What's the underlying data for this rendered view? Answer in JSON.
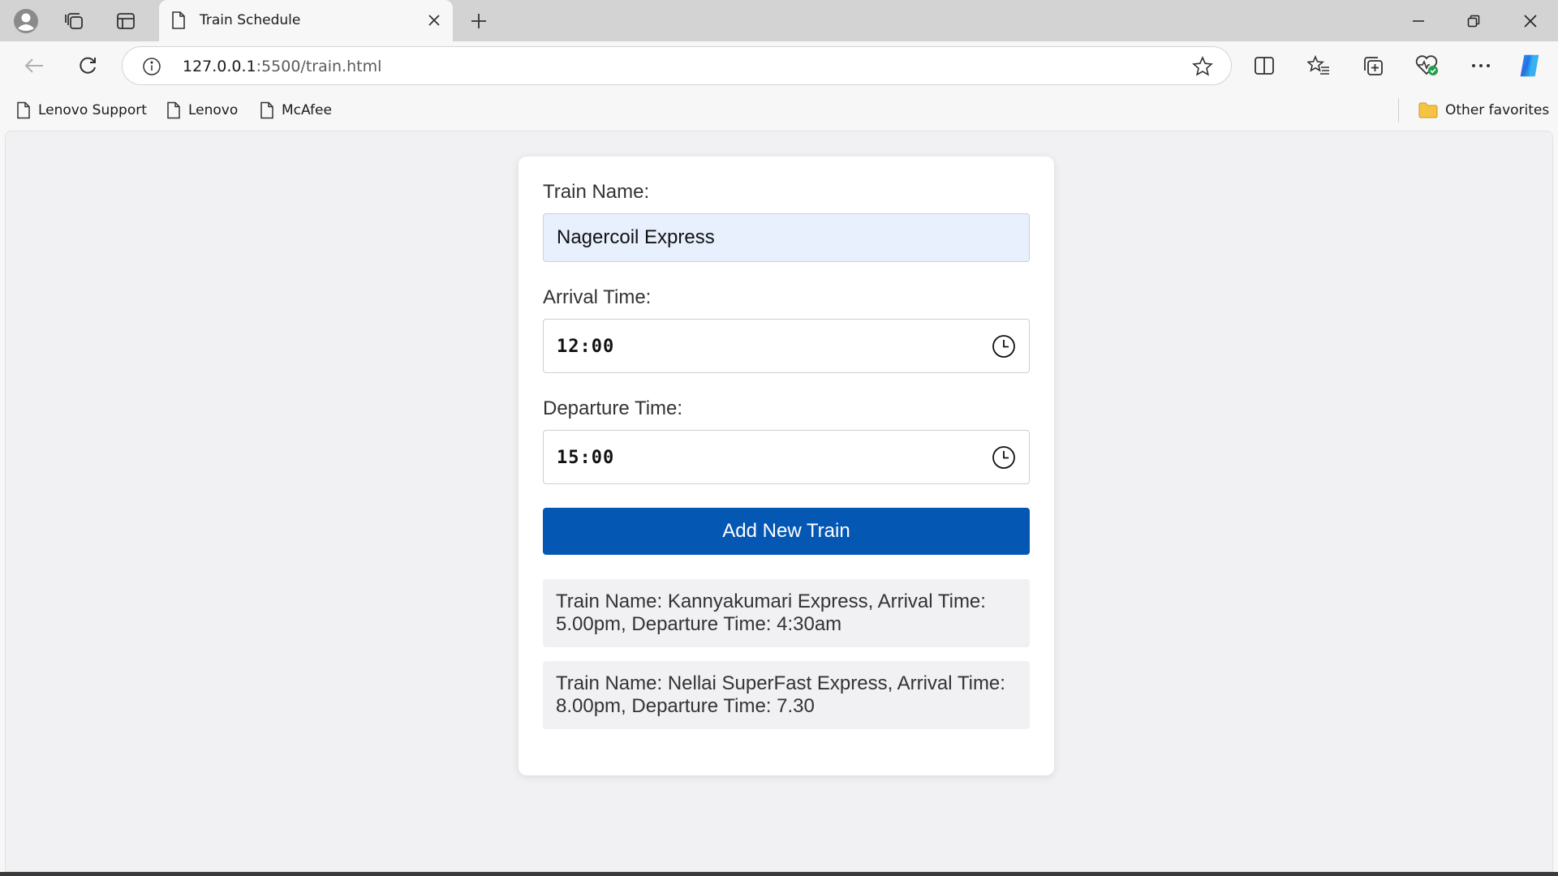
{
  "browser": {
    "tab_title": "Train Schedule",
    "url_host": "127.0.0.1",
    "url_rest": ":5500/train.html",
    "favorites": [
      {
        "label": "Lenovo Support"
      },
      {
        "label": "Lenovo"
      },
      {
        "label": "McAfee"
      }
    ],
    "other_favorites": "Other favorites"
  },
  "form": {
    "train_name_label": "Train Name:",
    "train_name_value": "Nagercoil Express",
    "arrival_label": "Arrival Time:",
    "arrival_value": "12:00",
    "departure_label": "Departure Time:",
    "departure_value": "15:00",
    "add_button": "Add New Train"
  },
  "trains": [
    {
      "line1": "Train Name: Kannyakumari Express, Arrival Time:",
      "line2": "5.00pm, Departure Time: 4:30am"
    },
    {
      "line1": "Train Name: Nellai SuperFast Express, Arrival Time:",
      "line2": "8.00pm, Departure Time: 7.30"
    }
  ],
  "colors": {
    "button": "#0557b4",
    "autofill": "#e8f0fe",
    "copilot_accent": "#1aa3f0"
  }
}
